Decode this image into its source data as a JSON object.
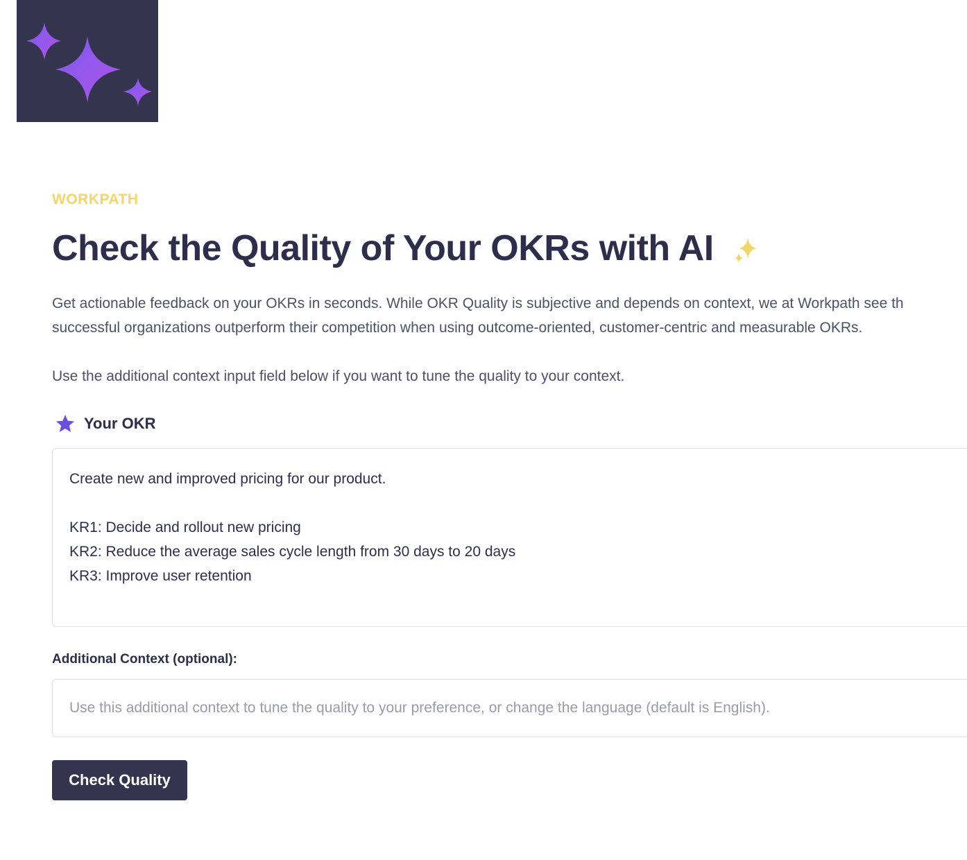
{
  "brand": {
    "name": "WORKPATH",
    "logo_icon": "sparkles-icon",
    "brand_color": "#f2d66b",
    "tile_color": "#34344f"
  },
  "header": {
    "title": "Check the Quality of Your OKRs with AI",
    "title_icon": "sparkle-icon"
  },
  "intro": {
    "line1": "Get actionable feedback on your OKRs in seconds. While OKR Quality is subjective and depends on context, we at Workpath see th",
    "line2": "successful organizations outperform their competition when using outcome-oriented, customer-centric and measurable OKRs.",
    "hint": "Use the additional context input field below if you want to tune the quality to your context."
  },
  "okr": {
    "label": "Your OKR",
    "icon": "star-icon",
    "lines": [
      "Create new and improved pricing for our product.",
      "",
      "KR1: Decide and rollout new pricing",
      "KR2: Reduce the average sales cycle length from 30 days to 20 days",
      "KR3: Improve user retention"
    ]
  },
  "context": {
    "label": "Additional Context (optional):",
    "placeholder": "Use this additional context to tune the quality to your preference, or change the language (default is English)."
  },
  "actions": {
    "check_label": "Check Quality"
  }
}
